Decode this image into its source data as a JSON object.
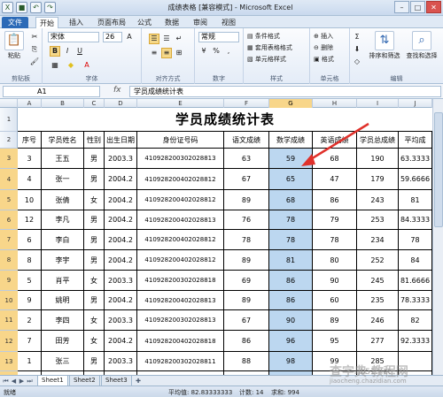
{
  "titlebar": {
    "title": "成绩表格 [兼容模式] - Microsoft Excel",
    "min": "–",
    "max": "□",
    "close": "✕"
  },
  "ribbon_tabs": {
    "file": "文件",
    "items": [
      "开始",
      "插入",
      "页面布局",
      "公式",
      "数据",
      "审阅",
      "视图"
    ],
    "active": "开始"
  },
  "ribbon": {
    "paste": "粘贴",
    "font_name": "宋体",
    "font_size": "26",
    "number_format": "常规",
    "cond_format": "条件格式",
    "table_format": "套用表格格式",
    "cell_style": "单元格样式",
    "insert": "插入",
    "delete": "删除",
    "format": "格式",
    "sort_filter": "排序和筛选",
    "find_select": "查找和选择",
    "groups": {
      "clipboard": "剪贴板",
      "font": "字体",
      "align": "对齐方式",
      "number": "数字",
      "style": "样式",
      "cells": "单元格",
      "edit": "编辑"
    }
  },
  "formula_bar": {
    "name_box": "A1",
    "fx": "fx",
    "content": "学员成绩统计表"
  },
  "sheet": {
    "columns": [
      "A",
      "B",
      "C",
      "D",
      "E",
      "F",
      "G",
      "H",
      "I",
      "J"
    ],
    "row_numbers": [
      "1",
      "2",
      "3",
      "4",
      "5",
      "6",
      "7",
      "8",
      "9",
      "10",
      "11",
      "12",
      "13",
      "14"
    ],
    "title": "学员成绩统计表",
    "headers": [
      "序号",
      "学员姓名",
      "性别",
      "出生日期",
      "身份证号码",
      "语文成绩",
      "数学成绩",
      "英语成绩",
      "学员总成绩",
      "平均成"
    ],
    "rows": [
      [
        "3",
        "王五",
        "男",
        "2003.3",
        "410928200302028813",
        "63",
        "59",
        "68",
        "190",
        "63.3333"
      ],
      [
        "4",
        "张一",
        "男",
        "2004.2",
        "410928200402028812",
        "67",
        "65",
        "47",
        "179",
        "59.6666"
      ],
      [
        "10",
        "张倩",
        "女",
        "2004.2",
        "410928200402028812",
        "89",
        "68",
        "86",
        "243",
        "81"
      ],
      [
        "12",
        "李凡",
        "男",
        "2004.2",
        "410928200402028813",
        "76",
        "78",
        "79",
        "253",
        "84.3333"
      ],
      [
        "6",
        "李白",
        "男",
        "2004.2",
        "410928200402028812",
        "78",
        "78",
        "78",
        "234",
        "78"
      ],
      [
        "8",
        "李宇",
        "男",
        "2004.2",
        "410928200402028812",
        "89",
        "81",
        "80",
        "252",
        "84"
      ],
      [
        "5",
        "肖平",
        "女",
        "2003.3",
        "410928200302028818",
        "69",
        "86",
        "90",
        "245",
        "81.6666"
      ],
      [
        "9",
        "姚明",
        "男",
        "2004.2",
        "410928200402028813",
        "89",
        "86",
        "60",
        "235",
        "78.3333"
      ],
      [
        "2",
        "李四",
        "女",
        "2003.3",
        "410928200302028813",
        "67",
        "90",
        "89",
        "246",
        "82"
      ],
      [
        "7",
        "田芳",
        "女",
        "2004.2",
        "410928200402028818",
        "86",
        "96",
        "95",
        "277",
        "92.3333"
      ],
      [
        "1",
        "张三",
        "男",
        "2003.3",
        "410928200302028811",
        "88",
        "98",
        "99",
        "285",
        ""
      ],
      [
        "11",
        "王丽",
        "女",
        "2004.2",
        "410928200402028818",
        "93",
        "98",
        "",
        "",
        ""
      ]
    ]
  },
  "sheet_tabs": [
    "Sheet1",
    "Sheet2",
    "Sheet3"
  ],
  "status": {
    "ready": "就绪",
    "average": "平均值: 82.83333333",
    "count": "计数: 14",
    "sum": "求和: 994"
  },
  "watermark": {
    "main": "查字典 教程网",
    "site": "jb51.net",
    "url": "jiaocheng.chazidian.com"
  },
  "colors": {
    "selection": "#bcd7f0",
    "selected_header": "#f8d68a",
    "arrow": "#e0312b",
    "file_tab": "#2b6ab7"
  }
}
